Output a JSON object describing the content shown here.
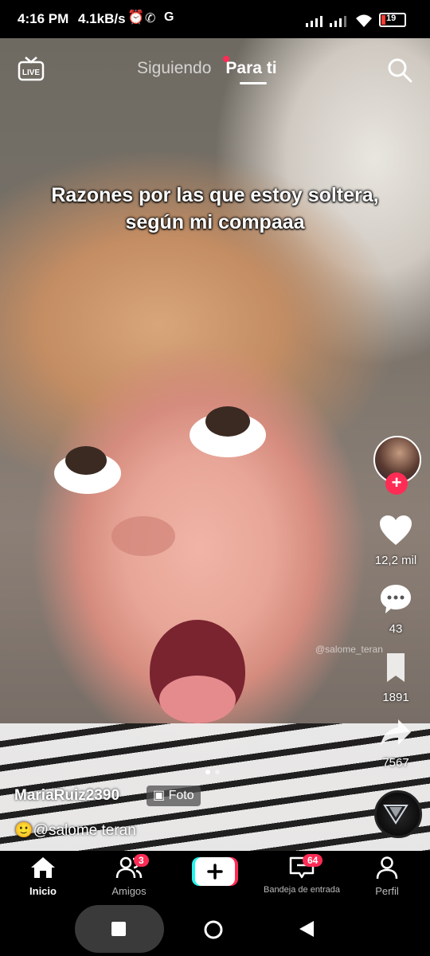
{
  "status_bar": {
    "time": "4:16 PM",
    "speed": "4.1kB/s",
    "battery": "19"
  },
  "top_nav": {
    "tab_following": "Siguiendo",
    "tab_for_you": "Para ti",
    "live_label": "LIVE"
  },
  "video": {
    "caption": "Razones por las que estoy soltera, según mi compaaa",
    "overlay_username": "@salome_teran",
    "author": "MariaRuiz2390",
    "badge": "Foto",
    "mention": "@salome teran",
    "slide_count": 2,
    "slide_active": 1
  },
  "actions": {
    "likes": "12,2 mil",
    "comments": "43",
    "saves": "1891",
    "shares": "7567"
  },
  "bottom_nav": {
    "home": "Inicio",
    "friends": "Amigos",
    "friends_badge": "3",
    "inbox": "Bandeja de entrada",
    "inbox_badge": "64",
    "profile": "Perfil"
  },
  "colors": {
    "accent": "#fe2c55",
    "cyan": "#25f4ee"
  }
}
